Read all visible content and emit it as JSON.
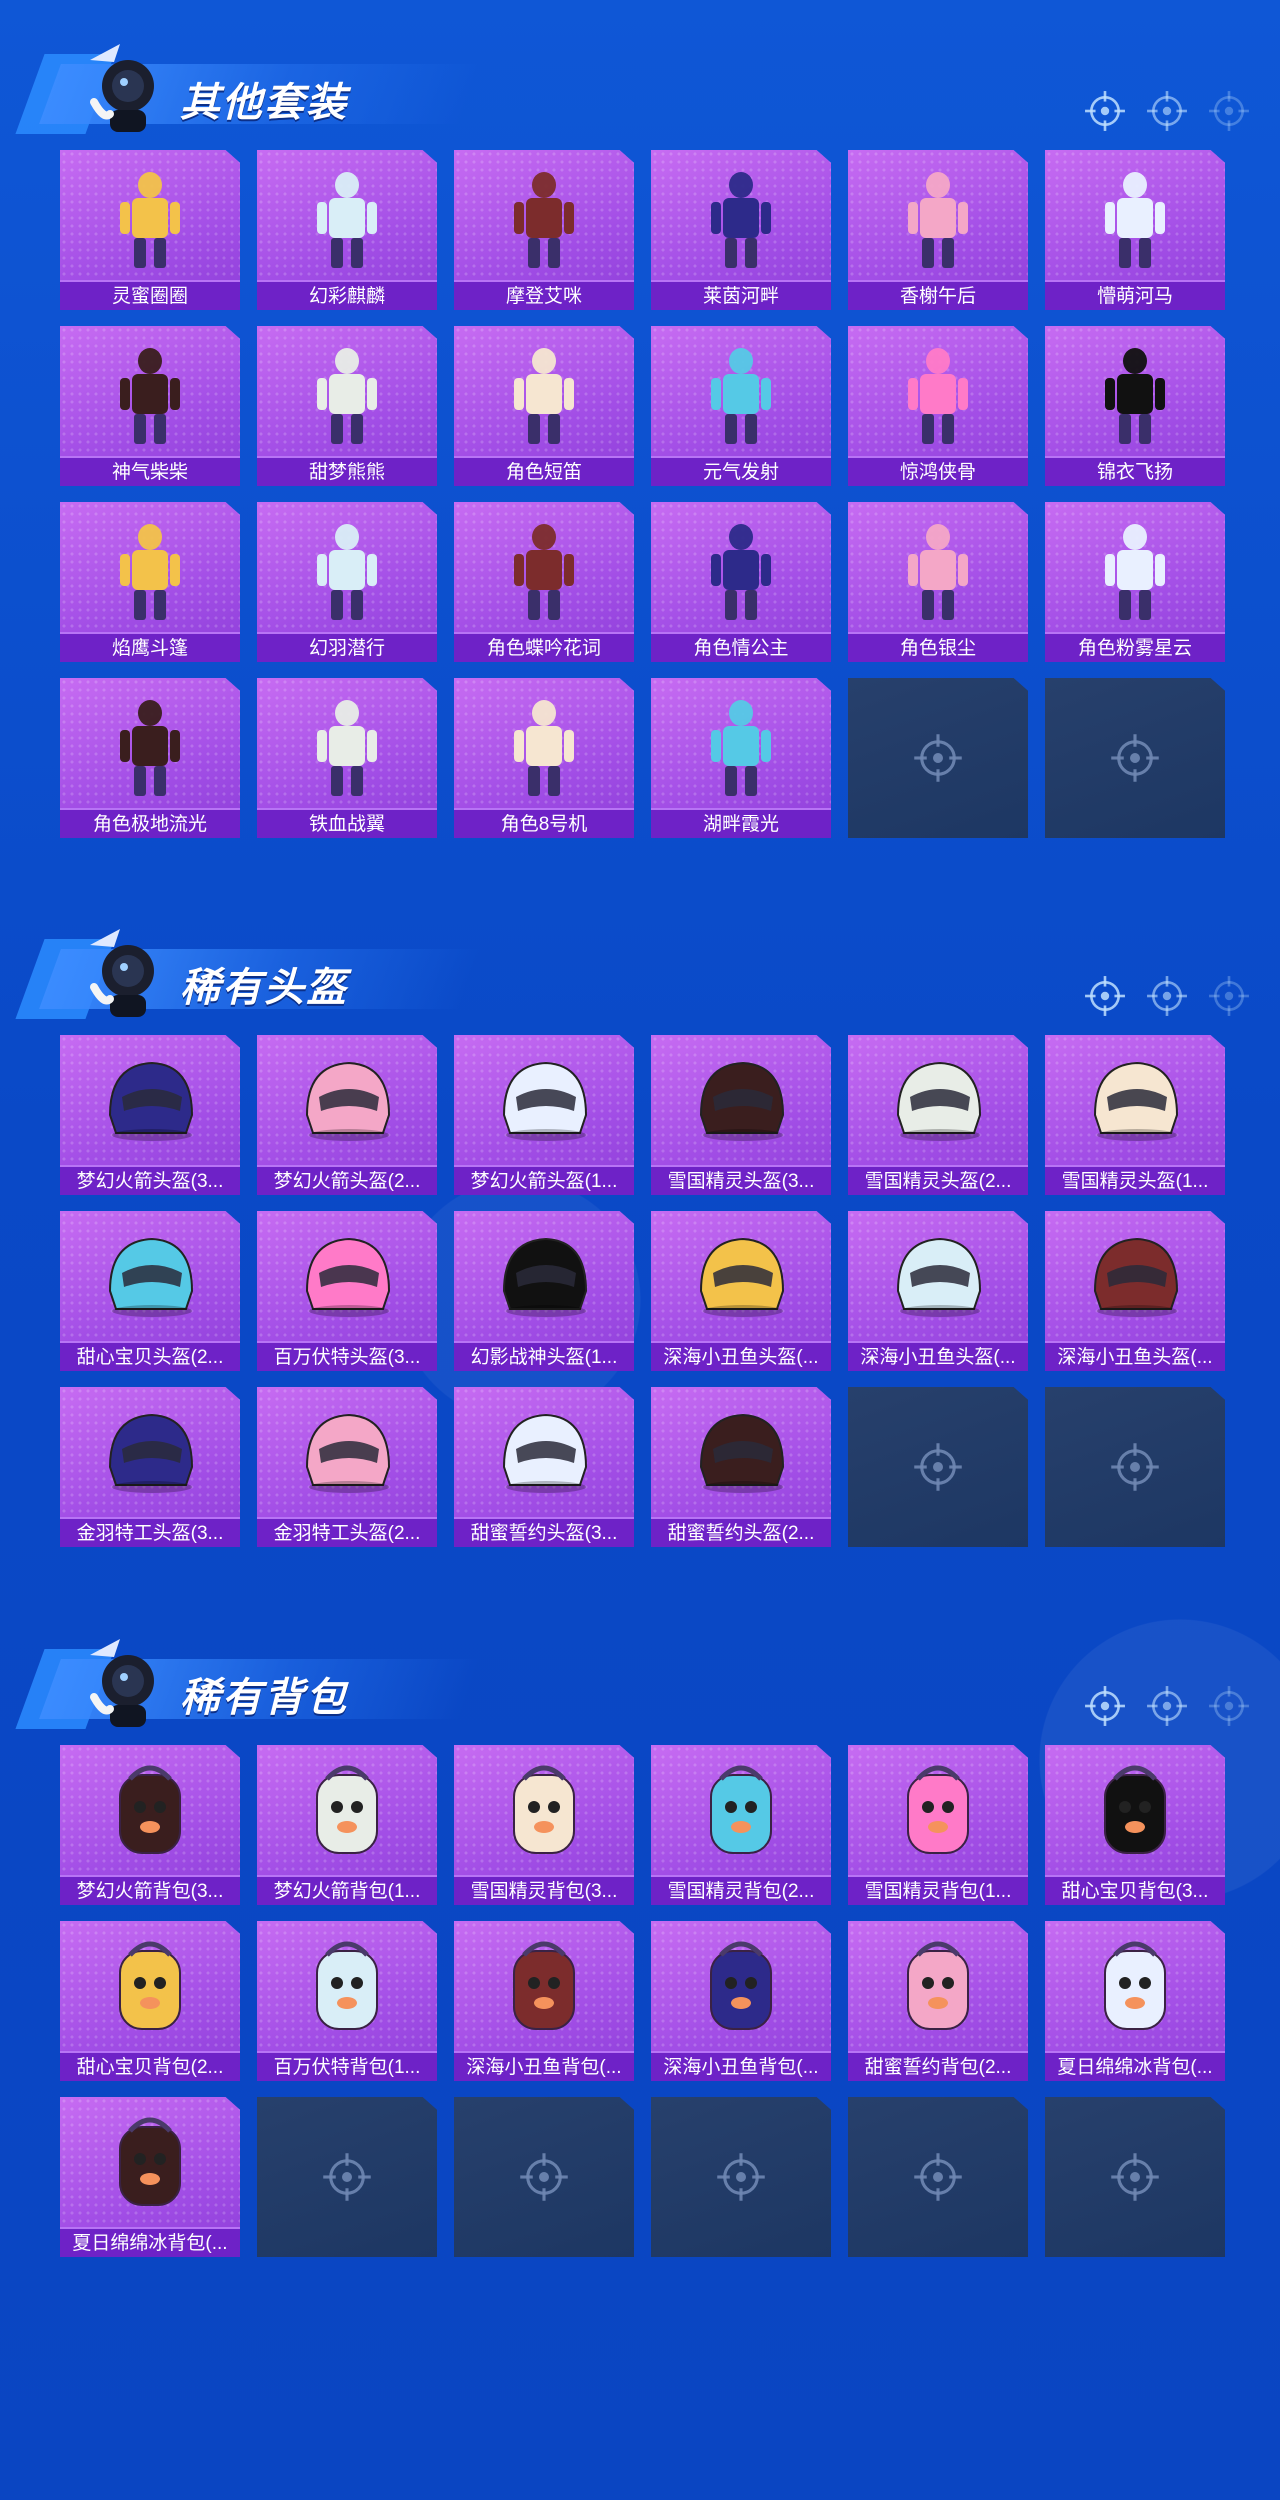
{
  "sections": [
    {
      "title": "其他套装",
      "items": [
        "灵蜜圈圈",
        "幻彩麒麟",
        "摩登艾咪",
        "莱茵河畔",
        "香榭午后",
        "懵萌河马",
        "神气柴柴",
        "甜梦熊熊",
        "角色短笛",
        "元气发射",
        "惊鸿侠骨",
        "锦衣飞扬",
        "焰鹰斗篷",
        "幻羽潜行",
        "角色蝶吟花词",
        "角色情公主",
        "角色银尘",
        "角色粉雾星云",
        "角色极地流光",
        "铁血战翼",
        "角色8号机",
        "湖畔霞光"
      ],
      "empty_slots": 2
    },
    {
      "title": "稀有头盔",
      "items": [
        "梦幻火箭头盔(3...",
        "梦幻火箭头盔(2...",
        "梦幻火箭头盔(1...",
        "雪国精灵头盔(3...",
        "雪国精灵头盔(2...",
        "雪国精灵头盔(1...",
        "甜心宝贝头盔(2...",
        "百万伏特头盔(3...",
        "幻影战神头盔(1...",
        "深海小丑鱼头盔(...",
        "深海小丑鱼头盔(...",
        "深海小丑鱼头盔(...",
        "金羽特工头盔(3...",
        "金羽特工头盔(2...",
        "甜蜜誓约头盔(3...",
        "甜蜜誓约头盔(2..."
      ],
      "empty_slots": 2
    },
    {
      "title": "稀有背包",
      "items": [
        "梦幻火箭背包(3...",
        "梦幻火箭背包(1...",
        "雪国精灵背包(3...",
        "雪国精灵背包(2...",
        "雪国精灵背包(1...",
        "甜心宝贝背包(3...",
        "甜心宝贝背包(2...",
        "百万伏特背包(1...",
        "深海小丑鱼背包(...",
        "深海小丑鱼背包(...",
        "甜蜜誓约背包(2...",
        "夏日绵绵冰背包(...",
        "夏日绵绵冰背包(..."
      ],
      "empty_slots": 5
    }
  ],
  "colors": {
    "background": "#0a49c7",
    "card": "#a24ee6",
    "label_bar": "#6e22c7",
    "empty_slot": "#1f3a66"
  },
  "icons": {
    "section_targets": "crosshair-icon",
    "empty_slot": "crosshair-icon",
    "mascot": "mascot-icon"
  }
}
